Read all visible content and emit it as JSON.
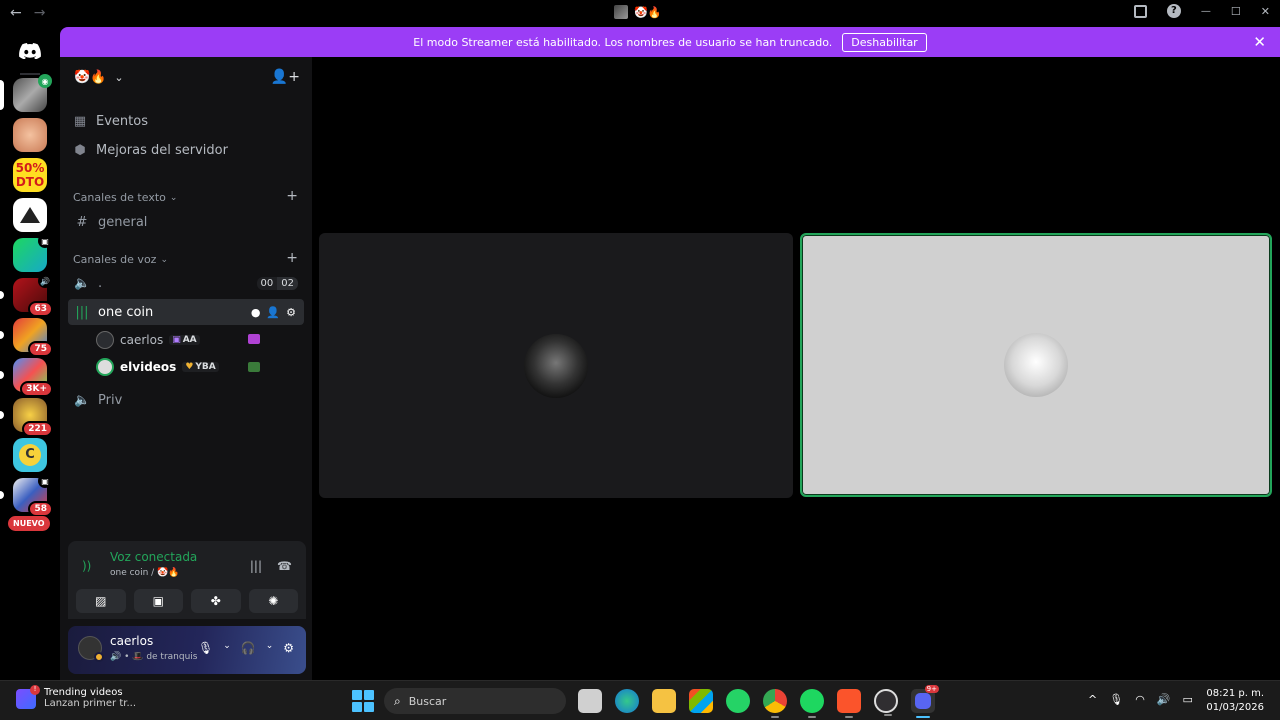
{
  "titlebar": {
    "back": "←",
    "forward": "→",
    "window_controls": {
      "minimize": "—",
      "maximize": "☐",
      "close": "✕"
    }
  },
  "banner": {
    "message": "El modo Streamer está habilitado. Los nombres de usuario se han truncado.",
    "button": "Deshabilitar",
    "close": "✕",
    "color": "#9b3df6"
  },
  "rail": {
    "badges": [
      "63",
      "75",
      "3K+",
      "221",
      "58"
    ],
    "nuevo": "NUEVO"
  },
  "sidebar": {
    "server_name_emoji": "🤡🔥",
    "items": [
      {
        "icon": "calendar-icon",
        "label": "Eventos"
      },
      {
        "icon": "boost-icon",
        "label": "Mejoras del servidor"
      }
    ],
    "text_category": "Canales de texto",
    "text_channels": [
      {
        "label": "general"
      }
    ],
    "voice_category": "Canales de voz",
    "voice_channels": [
      {
        "label": ".",
        "count_a": "00",
        "count_b": "02"
      },
      {
        "label": "one coin",
        "active": true
      },
      {
        "label": "Priv"
      }
    ],
    "voice_members": [
      {
        "name": "caerlos",
        "tag": "AA"
      },
      {
        "name": "elvideos",
        "tag": "YBA"
      }
    ]
  },
  "voice_panel": {
    "title": "Voz conectada",
    "subtitle": "one coin / 🤡🔥",
    "accent": "#23a55a"
  },
  "user": {
    "name": "caerlos",
    "status": "de tranquis"
  },
  "taskbar": {
    "news_title": "Trending videos",
    "news_sub": "Lanzan primer tr...",
    "search_placeholder": "Buscar",
    "discord_badge": "9+",
    "time": "08:21 p. m.",
    "date": "01/03/2026"
  }
}
